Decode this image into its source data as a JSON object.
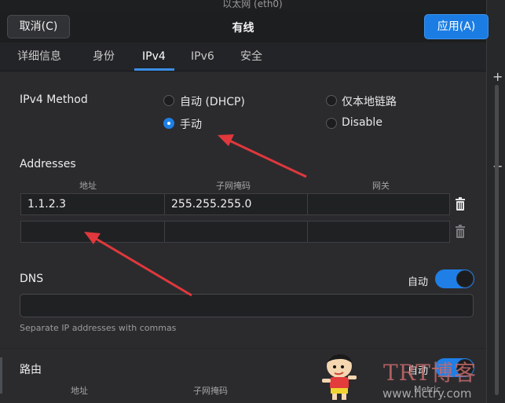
{
  "window": {
    "bg_title": "以太网 (eth0)",
    "title": "有线"
  },
  "header": {
    "cancel_label": "取消(C)",
    "apply_label": "应用(A)"
  },
  "tabs": [
    {
      "label": "详细信息",
      "active": false
    },
    {
      "label": "身份",
      "active": false
    },
    {
      "label": "IPv4",
      "active": true
    },
    {
      "label": "IPv6",
      "active": false
    },
    {
      "label": "安全",
      "active": false
    }
  ],
  "ipv4": {
    "method_label": "IPv4 Method",
    "options": [
      {
        "label": "自动 (DHCP)",
        "checked": false
      },
      {
        "label": "仅本地链路",
        "checked": false
      },
      {
        "label": "手动",
        "checked": true
      },
      {
        "label": "Disable",
        "checked": false
      }
    ]
  },
  "addresses": {
    "title": "Addresses",
    "columns": [
      "地址",
      "子网掩码",
      "网关"
    ],
    "rows": [
      [
        "1.1.2.3",
        "255.255.255.0",
        ""
      ],
      [
        "",
        "",
        ""
      ]
    ]
  },
  "dns": {
    "title": "DNS",
    "auto_label": "自动",
    "auto_on": true,
    "value": "",
    "hint": "Separate IP addresses with commas"
  },
  "routes": {
    "title": "路由",
    "auto_label": "自动",
    "auto_on": true,
    "columns": [
      "地址",
      "子网掩码",
      "Metric"
    ]
  },
  "watermark": {
    "text": "TRT博客",
    "url": "www.hctry.com"
  },
  "colors": {
    "accent": "#1b7de3",
    "annotation_arrow": "#e0383c",
    "background": "#2b2b2e"
  }
}
